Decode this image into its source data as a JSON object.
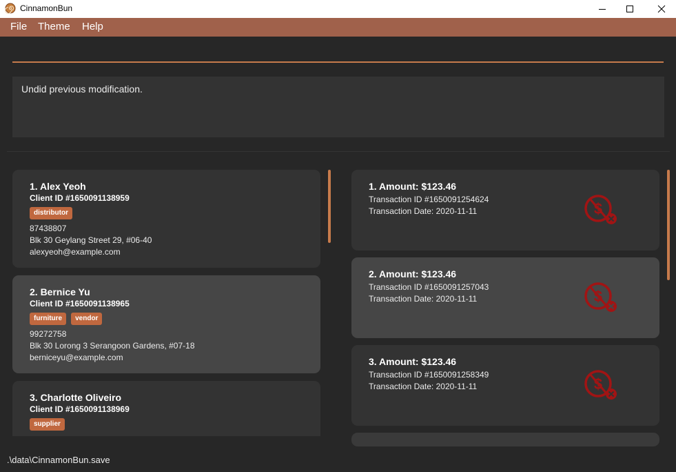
{
  "window": {
    "title": "CinnamonBun"
  },
  "menu": {
    "file": "File",
    "theme": "Theme",
    "help": "Help"
  },
  "result": {
    "text": "Undid previous modification."
  },
  "clients": [
    {
      "index_name": "1.  Alex Yeoh",
      "client_id": "Client ID #1650091138959",
      "tags": [
        "distributor"
      ],
      "phone": "87438807",
      "address": "Blk 30 Geylang Street 29, #06-40",
      "email": "alexyeoh@example.com"
    },
    {
      "index_name": "2.  Bernice Yu",
      "client_id": "Client ID #1650091138965",
      "tags": [
        "furniture",
        "vendor"
      ],
      "phone": "99272758",
      "address": "Blk 30 Lorong 3 Serangoon Gardens, #07-18",
      "email": "berniceyu@example.com"
    },
    {
      "index_name": "3.  Charlotte Oliveiro",
      "client_id": "Client ID #1650091138969",
      "tags": [
        "supplier"
      ]
    }
  ],
  "transactions": [
    {
      "amount": "1. Amount: $123.46",
      "txn_id": "Transaction ID #1650091254624",
      "date": "Transaction Date: 2020-11-11",
      "status_icon": "unpaid-icon"
    },
    {
      "amount": "2. Amount: $123.46",
      "txn_id": "Transaction ID #1650091257043",
      "date": "Transaction Date: 2020-11-11",
      "status_icon": "unpaid-icon"
    },
    {
      "amount": "3. Amount: $123.46",
      "txn_id": "Transaction ID #1650091258349",
      "date": "Transaction Date: 2020-11-11",
      "status_icon": "unpaid-icon"
    }
  ],
  "status_bar": {
    "path": ".\\data\\CinnamonBun.save"
  },
  "colors": {
    "accent": "#c77b4c",
    "menubar": "#a0614b",
    "tag": "#c0683f",
    "unpaid_icon": "#a11414"
  }
}
